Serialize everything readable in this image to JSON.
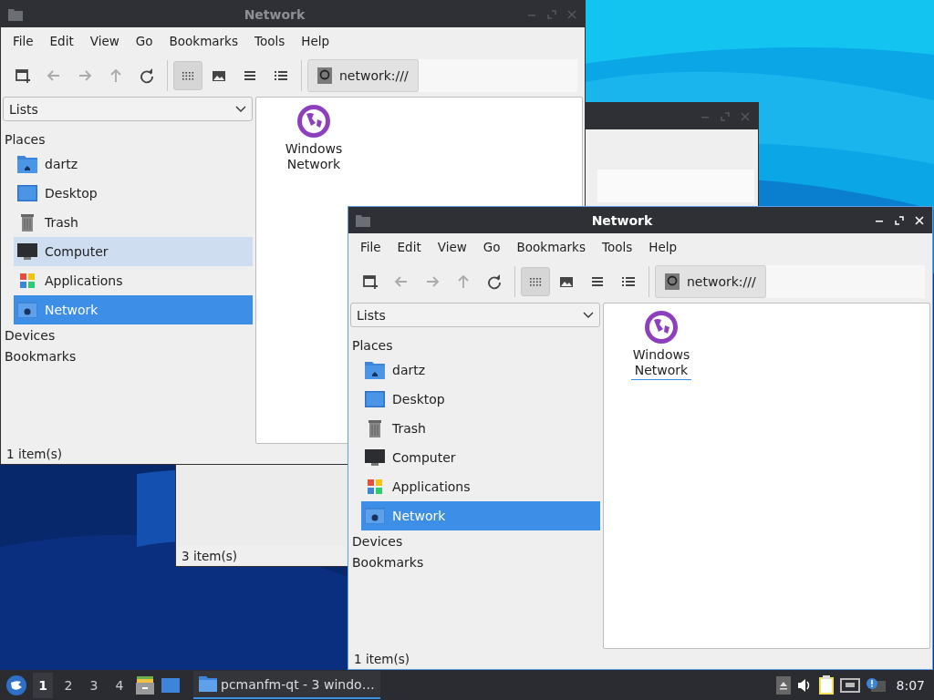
{
  "background_window": {
    "status": "3 item(s)"
  },
  "windows": [
    {
      "title": "Network",
      "active": false,
      "menu": [
        "File",
        "Edit",
        "View",
        "Go",
        "Bookmarks",
        "Tools",
        "Help"
      ],
      "toolbar": [
        {
          "kind": "new-window",
          "disabled": false,
          "selected": false
        },
        {
          "kind": "back",
          "disabled": true,
          "selected": false
        },
        {
          "kind": "forward",
          "disabled": true,
          "selected": false
        },
        {
          "kind": "up",
          "disabled": true,
          "selected": false
        },
        {
          "kind": "reload",
          "disabled": false,
          "selected": false
        },
        {
          "kind": "icon-view",
          "disabled": false,
          "selected": true
        },
        {
          "kind": "thumbnail-view",
          "disabled": false,
          "selected": false
        },
        {
          "kind": "compact-view",
          "disabled": false,
          "selected": false
        },
        {
          "kind": "detail-view",
          "disabled": false,
          "selected": false
        }
      ],
      "path": "network:///",
      "panel_mode": "Lists",
      "sections": [
        {
          "label": "Places",
          "items": [
            {
              "kind": "home",
              "label": "dartz",
              "selected": false,
              "hovered": false
            },
            {
              "kind": "desktop",
              "label": "Desktop",
              "selected": false,
              "hovered": false
            },
            {
              "kind": "trash",
              "label": "Trash",
              "selected": false,
              "hovered": false
            },
            {
              "kind": "computer",
              "label": "Computer",
              "selected": false,
              "hovered": true
            },
            {
              "kind": "applications",
              "label": "Applications",
              "selected": false,
              "hovered": false
            },
            {
              "kind": "network",
              "label": "Network",
              "selected": true,
              "hovered": false
            }
          ]
        },
        {
          "label": "Devices"
        },
        {
          "label": "Bookmarks"
        }
      ],
      "files": [
        {
          "label": "Windows Network",
          "focused": false
        }
      ],
      "status": "1 item(s)"
    },
    {
      "title": "Network",
      "active": true,
      "menu": [
        "File",
        "Edit",
        "View",
        "Go",
        "Bookmarks",
        "Tools",
        "Help"
      ],
      "toolbar": [
        {
          "kind": "new-window",
          "disabled": false,
          "selected": false
        },
        {
          "kind": "back",
          "disabled": true,
          "selected": false
        },
        {
          "kind": "forward",
          "disabled": true,
          "selected": false
        },
        {
          "kind": "up",
          "disabled": true,
          "selected": false
        },
        {
          "kind": "reload",
          "disabled": false,
          "selected": false
        },
        {
          "kind": "icon-view",
          "disabled": false,
          "selected": true
        },
        {
          "kind": "thumbnail-view",
          "disabled": false,
          "selected": false
        },
        {
          "kind": "compact-view",
          "disabled": false,
          "selected": false
        },
        {
          "kind": "detail-view",
          "disabled": false,
          "selected": false
        }
      ],
      "path": "network:///",
      "panel_mode": "Lists",
      "sections": [
        {
          "label": "Places",
          "items": [
            {
              "kind": "home",
              "label": "dartz",
              "selected": false,
              "hovered": false
            },
            {
              "kind": "desktop",
              "label": "Desktop",
              "selected": false,
              "hovered": false
            },
            {
              "kind": "trash",
              "label": "Trash",
              "selected": false,
              "hovered": false
            },
            {
              "kind": "computer",
              "label": "Computer",
              "selected": false,
              "hovered": false
            },
            {
              "kind": "applications",
              "label": "Applications",
              "selected": false,
              "hovered": false
            },
            {
              "kind": "network",
              "label": "Network",
              "selected": true,
              "hovered": false
            }
          ]
        },
        {
          "label": "Devices"
        },
        {
          "label": "Bookmarks"
        }
      ],
      "files": [
        {
          "label": "Windows Network",
          "focused": true
        }
      ],
      "status": "1 item(s)"
    }
  ],
  "taskbar": {
    "desktops": [
      {
        "label": "1",
        "selected": true
      },
      {
        "label": "2",
        "selected": false
      },
      {
        "label": "3",
        "selected": false
      },
      {
        "label": "4",
        "selected": false
      }
    ],
    "tasks": [
      {
        "label": "pcmanfm-qt - 3 windo…",
        "selected": true
      }
    ],
    "clock": "8:07"
  }
}
